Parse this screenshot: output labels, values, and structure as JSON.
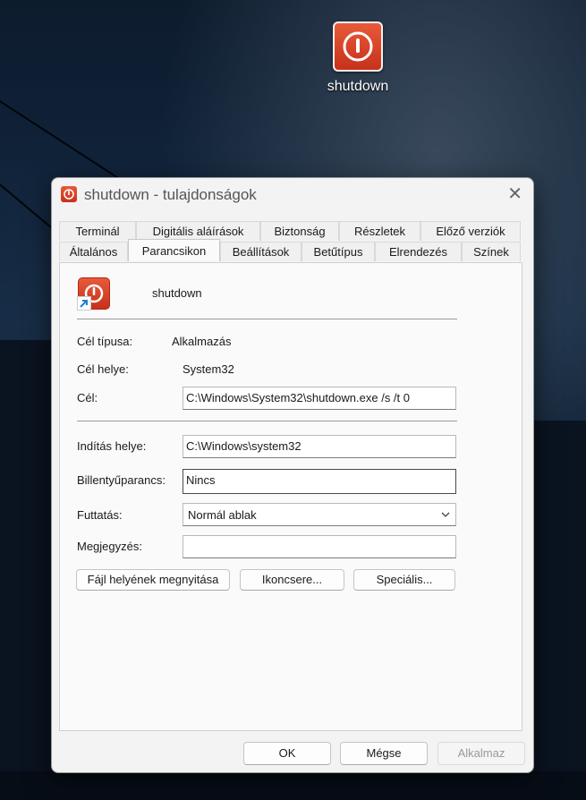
{
  "desktop": {
    "icon_label": "shutdown"
  },
  "dialog": {
    "title": "shutdown - tulajdonságok",
    "close_glyph": "✕",
    "tabs_row1": [
      "Terminál",
      "Digitális aláírások",
      "Biztonság",
      "Részletek",
      "Előző verziók"
    ],
    "tabs_row2": [
      "Általános",
      "Parancsikon",
      "Beállítások",
      "Betűtípus",
      "Elrendezés",
      "Színek"
    ],
    "active_tab": "Parancsikon",
    "shortcut_name": "shutdown",
    "target_type_label": "Cél típusa:",
    "target_type_value": "Alkalmazás",
    "target_location_label": "Cél helye:",
    "target_location_value": "System32",
    "target_label": "Cél:",
    "target_value": "C:\\Windows\\System32\\shutdown.exe /s /t 0",
    "start_in_label": "Indítás helye:",
    "start_in_value": "C:\\Windows\\system32",
    "shortcut_key_label": "Billentyűparancs:",
    "shortcut_key_value": "Nincs",
    "run_label": "Futtatás:",
    "run_value": "Normál ablak",
    "comment_label": "Megjegyzés:",
    "comment_value": "",
    "open_location_button": "Fájl helyének megnyitása",
    "change_icon_button": "Ikoncsere...",
    "advanced_button": "Speciális...",
    "ok_button": "OK",
    "cancel_button": "Mégse",
    "apply_button": "Alkalmaz"
  },
  "colors": {
    "icon_red": "#d9402a",
    "panel_bg": "#fafafa",
    "dialog_bg": "#f3f3f3"
  },
  "icons": [
    "power-icon",
    "shortcut-arrow-icon",
    "close-icon",
    "chevron-down-icon"
  ]
}
